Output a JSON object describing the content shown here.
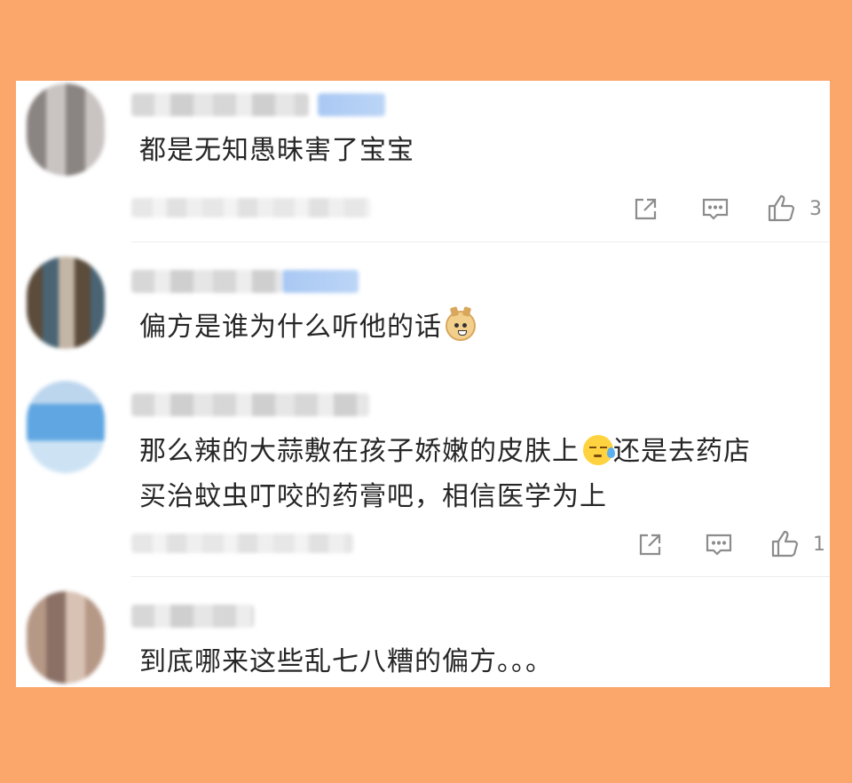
{
  "comments": [
    {
      "text": "都是无知愚昧害了宝宝",
      "emoji": "",
      "like_count": "3"
    },
    {
      "text": "偏方是谁为什么听他的话",
      "emoji": "doge-emoji"
    },
    {
      "line1": "那么辣的大蒜敷在孩子娇嫩的皮肤上",
      "line1_tail": "还是去药店",
      "line2": "买治蚊虫叮咬的药膏吧，相信医学为上",
      "emoji": "sweat-emoji",
      "like_count": "1"
    },
    {
      "text": "到底哪来这些乱七八糟的偏方。。。"
    }
  ],
  "icons": {
    "share": "share-icon",
    "comment": "comment-icon",
    "like": "thumbs-up-icon"
  },
  "colors": {
    "background": "#FBA66B",
    "panel": "#FFFFFF",
    "text": "#262626",
    "meta": "#8C8C8C"
  }
}
